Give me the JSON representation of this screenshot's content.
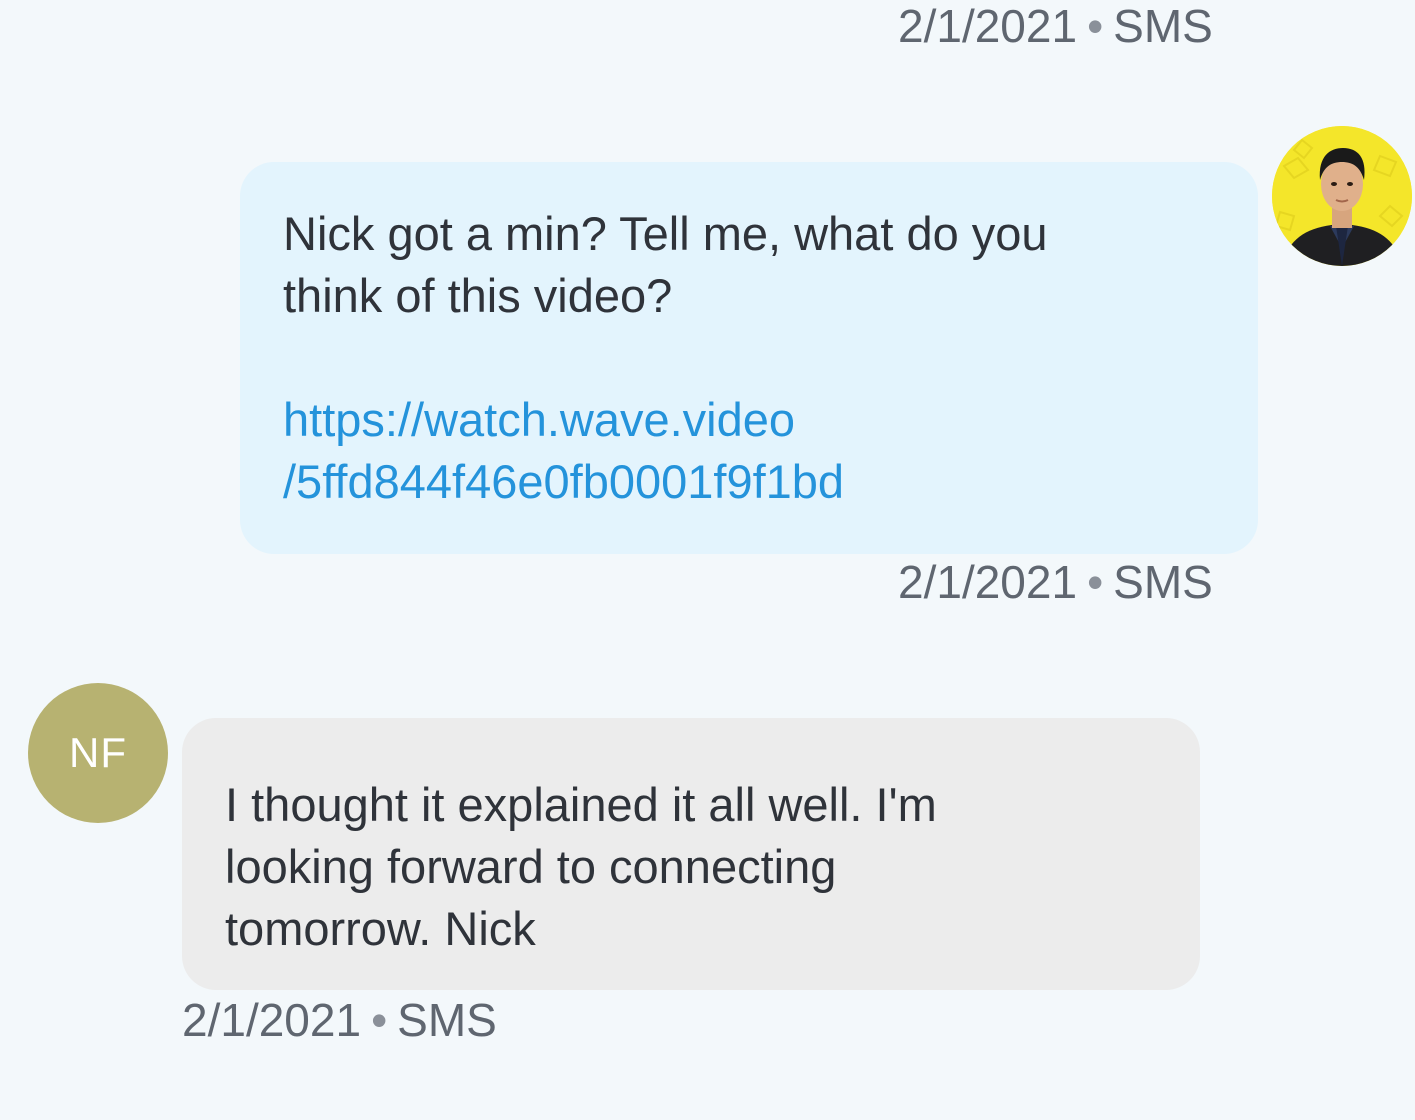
{
  "top_meta": {
    "date": "2/1/2021",
    "channel": "SMS"
  },
  "outgoing_message": {
    "text": "Nick got a min? Tell me, what do you\nthink of this video?",
    "link": "https://watch.wave.video\n/5ffd844f46e0fb0001f9f1bd",
    "meta": {
      "date": "2/1/2021",
      "channel": "SMS"
    },
    "avatar_icon": "user-photo-avatar"
  },
  "incoming_message": {
    "avatar_initials": "NF",
    "text": "I thought it explained it all well. I'm\nlooking forward to connecting\ntomorrow. Nick",
    "meta": {
      "date": "2/1/2021",
      "channel": "SMS"
    }
  },
  "colors": {
    "background": "#f3f8fb",
    "outgoing_bubble": "#e3f4fd",
    "incoming_bubble": "#ececec",
    "link": "#2493db",
    "initials_avatar": "#b7b271",
    "photo_avatar_bg": "#f4e62a"
  }
}
